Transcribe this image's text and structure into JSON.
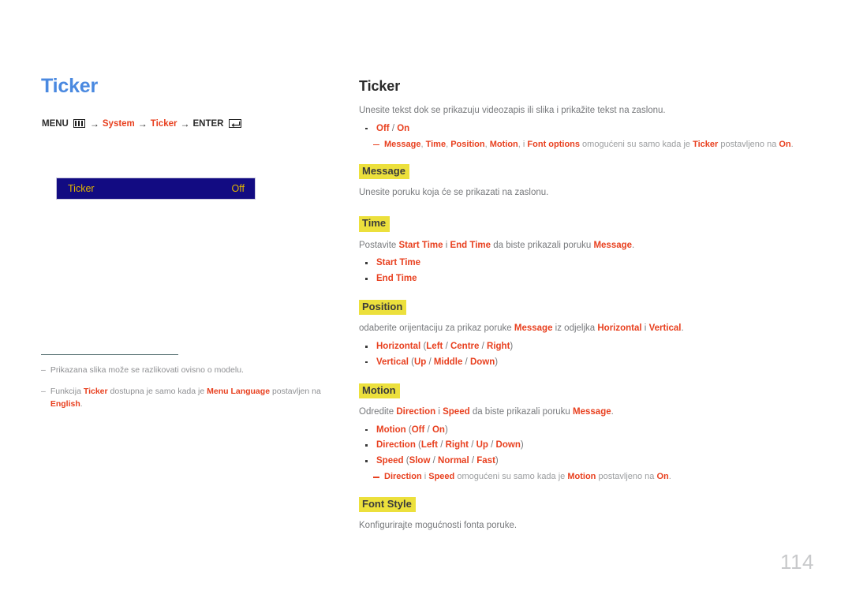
{
  "page": {
    "number": "114",
    "accent_blue": "#4a89e0",
    "accent_red": "#e8401f",
    "highlight_yellow": "#ece03c",
    "osd_background": "#120b82",
    "osd_text_color": "#e0b400"
  },
  "left": {
    "title": "Ticker",
    "menu_path": {
      "menu_label": "MENU",
      "menu_icon": "menu-bars-icon",
      "arrow1": "→",
      "item1": "System",
      "arrow2": "→",
      "item2": "Ticker",
      "arrow3": "→",
      "enter_label": "ENTER",
      "enter_icon": "enter-return-icon"
    },
    "osd": {
      "label": "Ticker",
      "value": "Off"
    },
    "notes": [
      {
        "dash": "–",
        "segments": [
          {
            "text": "Prikazana slika može se razlikovati ovisno o modelu.",
            "bold": false
          }
        ]
      },
      {
        "dash": "–",
        "segments": [
          {
            "text": "Funkcija ",
            "bold": false
          },
          {
            "text": "Ticker",
            "bold": true
          },
          {
            "text": " dostupna je samo kada je ",
            "bold": false
          },
          {
            "text": "Menu Language",
            "bold": true
          },
          {
            "text": " postavljen na ",
            "bold": false
          },
          {
            "text": "English",
            "bold": true
          },
          {
            "text": ".",
            "bold": false
          }
        ]
      }
    ]
  },
  "right": {
    "title": "Ticker",
    "intro": "Unesite tekst dok se prikazuju videozapis ili slika i prikažite tekst na zaslonu.",
    "intro_bullets": [
      {
        "label": "Off / On"
      }
    ],
    "intro_subnote": "Message, Time, Position, Motion, i Font options omogućeni su samo kada je Ticker postavljeno na On.",
    "sections": [
      {
        "heading": "Message",
        "description": "Unesite poruku koja će se prikazati na zaslonu.",
        "bullets": [],
        "subnote": null
      },
      {
        "heading": "Time",
        "description": "Postavite Start Time i End Time da biste prikazali poruku Message.",
        "bullets": [
          {
            "label": "Start Time",
            "options": ""
          },
          {
            "label": "End Time",
            "options": ""
          }
        ],
        "subnote": null
      },
      {
        "heading": "Position",
        "description": "odaberite orijentaciju za prikaz poruke Message iz odjeljka Horizontal i Vertical.",
        "bullets": [
          {
            "label": "Horizontal",
            "options": "(Left / Centre / Right)"
          },
          {
            "label": "Vertical",
            "options": "(Up / Middle / Down)"
          }
        ],
        "subnote": null
      },
      {
        "heading": "Motion",
        "description": "Odredite Direction i Speed da biste prikazali poruku Message.",
        "bullets": [
          {
            "label": "Motion",
            "options": "(Off / On)"
          },
          {
            "label": "Direction",
            "options": "(Left / Right / Up / Down)"
          },
          {
            "label": "Speed",
            "options": "(Slow / Normal / Fast)"
          }
        ],
        "subnote": "Direction i Speed omogućeni su samo kada je Motion postavljeno na On."
      },
      {
        "heading": "Font Style",
        "description": "Konfigurirajte mogućnosti fonta poruke.",
        "bullets": [],
        "subnote": null
      }
    ]
  }
}
